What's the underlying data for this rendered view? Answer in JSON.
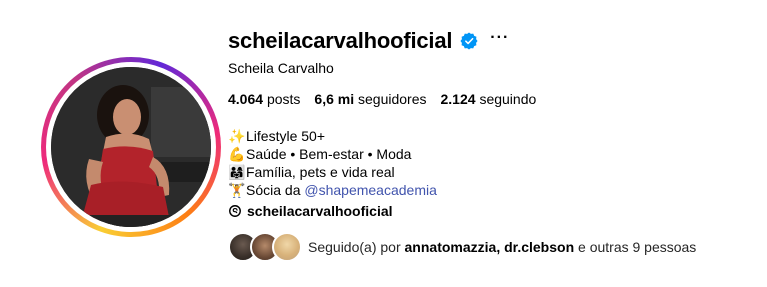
{
  "profile": {
    "username": "scheilacarvalhooficial",
    "full_name": "Scheila Carvalho",
    "more_label": "···",
    "verified_icon": "verified-badge-icon"
  },
  "stats": {
    "posts_count": "4.064",
    "posts_label": "posts",
    "followers_count": "6,6 mi",
    "followers_label": "seguidores",
    "following_count": "2.124",
    "following_label": "seguindo"
  },
  "bio": {
    "lines": [
      {
        "emoji": "✨",
        "text": "Lifestyle 50+"
      },
      {
        "emoji": "💪",
        "text": "Saúde • Bem-estar • Moda"
      },
      {
        "emoji": "👨‍👩‍👧",
        "text": "Família, pets e vida real"
      },
      {
        "emoji": "🏋️",
        "text": "Sócia da "
      }
    ],
    "mention": "@shapemeacademia"
  },
  "threads": {
    "handle": "scheilacarvalhooficial"
  },
  "followed_by": {
    "prefix": "Seguido(a) por ",
    "names": "annatomazzia, dr.clebson",
    "suffix": " e outras 9 pessoas"
  },
  "colors": {
    "verified": "#0095f6",
    "mention": "#4154ad",
    "ring_start": "#f9ce34",
    "ring_mid": "#ee2a7b",
    "ring_end": "#6228d7"
  }
}
